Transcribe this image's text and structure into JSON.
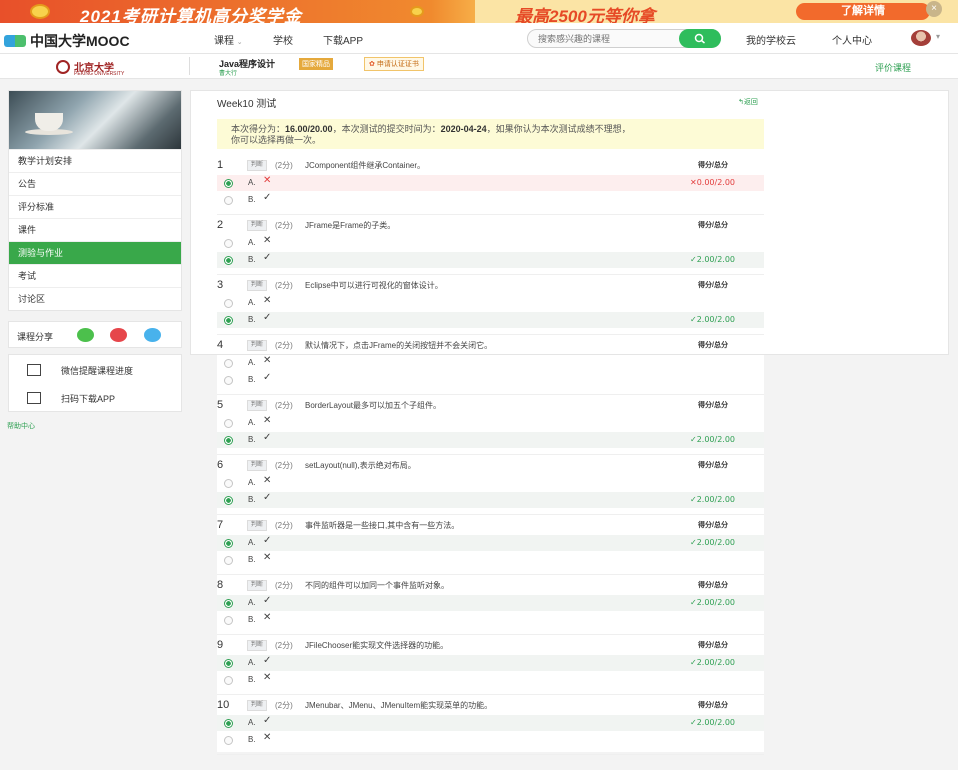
{
  "banner": {
    "title": "2021考研计算机高分奖学金",
    "prize": "最高2500元等你拿",
    "cta": "了解详情",
    "close": "×"
  },
  "topnav": {
    "logo": "中国大学MOOC",
    "links": [
      "课程",
      "学校",
      "下载APP"
    ],
    "search_placeholder": "搜索感兴趣的课程",
    "my_school_cloud": "我的学校云",
    "personal_center": "个人中心"
  },
  "course": {
    "school": "北京大学",
    "school_en": "PEKING UNIVERSITY",
    "title": "Java程序设计",
    "teacher": "曹大行",
    "national_tag": "国家精品",
    "cert_label": "申请认证证书",
    "evaluate": "评价课程"
  },
  "sidebar": {
    "items": [
      "教学计划安排",
      "公告",
      "评分标准",
      "课件",
      "测验与作业",
      "考试",
      "讨论区"
    ],
    "active_index": 4,
    "share_label": "课程分享",
    "wechat_progress": "微信提醒课程进度",
    "download_app": "扫码下载APP",
    "help": "帮助中心"
  },
  "quiz": {
    "title": "Week10 测试",
    "back": "返回",
    "notice_prefix": "本次得分为：",
    "score": "16.00/20.00",
    "notice_mid": "，本次测试的提交时间为：",
    "submit_time": "2020-04-24",
    "notice_suffix": "，如果你认为本次测试成绩不理想，",
    "notice_line2": "你可以选择再做一次。",
    "score_header": "得分/总分",
    "type_label": "判断",
    "points": "(2分)",
    "questions": [
      {
        "num": "1",
        "text": "JComponent组件继承Container。",
        "a": "✕",
        "b": "✓",
        "selected": "A",
        "score": "0.00/2.00",
        "correct": false
      },
      {
        "num": "2",
        "text": "JFrame是Frame的子类。",
        "a": "✕",
        "b": "✓",
        "selected": "B",
        "score": "2.00/2.00",
        "correct": true
      },
      {
        "num": "3",
        "text": "Eclipse中可以进行可视化的窗体设计。",
        "a": "✕",
        "b": "✓",
        "selected": "B",
        "score": "2.00/2.00",
        "correct": true
      },
      {
        "num": "4",
        "text": "默认情况下，点击JFrame的关闭按钮并不会关闭它。",
        "a": "✕",
        "b": "✓",
        "selected": "",
        "score": "",
        "correct": true
      },
      {
        "num": "5",
        "text": "BorderLayout最多可以加五个子组件。",
        "a": "✕",
        "b": "✓",
        "selected": "B",
        "score": "2.00/2.00",
        "correct": true
      },
      {
        "num": "6",
        "text": "setLayout(null),表示绝对布局。",
        "a": "✕",
        "b": "✓",
        "selected": "B",
        "score": "2.00/2.00",
        "correct": true
      },
      {
        "num": "7",
        "text": "事件监听器是一些接口,其中含有一些方法。",
        "a": "✓",
        "b": "✕",
        "selected": "A",
        "score": "2.00/2.00",
        "correct": true
      },
      {
        "num": "8",
        "text": "不同的组件可以加同一个事件监听对象。",
        "a": "✓",
        "b": "✕",
        "selected": "A",
        "score": "2.00/2.00",
        "correct": true
      },
      {
        "num": "9",
        "text": "JFileChooser能实现文件选择器的功能。",
        "a": "✓",
        "b": "✕",
        "selected": "A",
        "score": "2.00/2.00",
        "correct": true
      },
      {
        "num": "10",
        "text": "JMenubar、JMenu、JMenuItem能实现菜单的功能。",
        "a": "✓",
        "b": "✕",
        "selected": "A",
        "score": "2.00/2.00",
        "correct": true
      }
    ]
  },
  "colors": {
    "accent": "#39a84a",
    "wrong": "#e23d3d",
    "notice_bg": "#fdfbd6"
  }
}
